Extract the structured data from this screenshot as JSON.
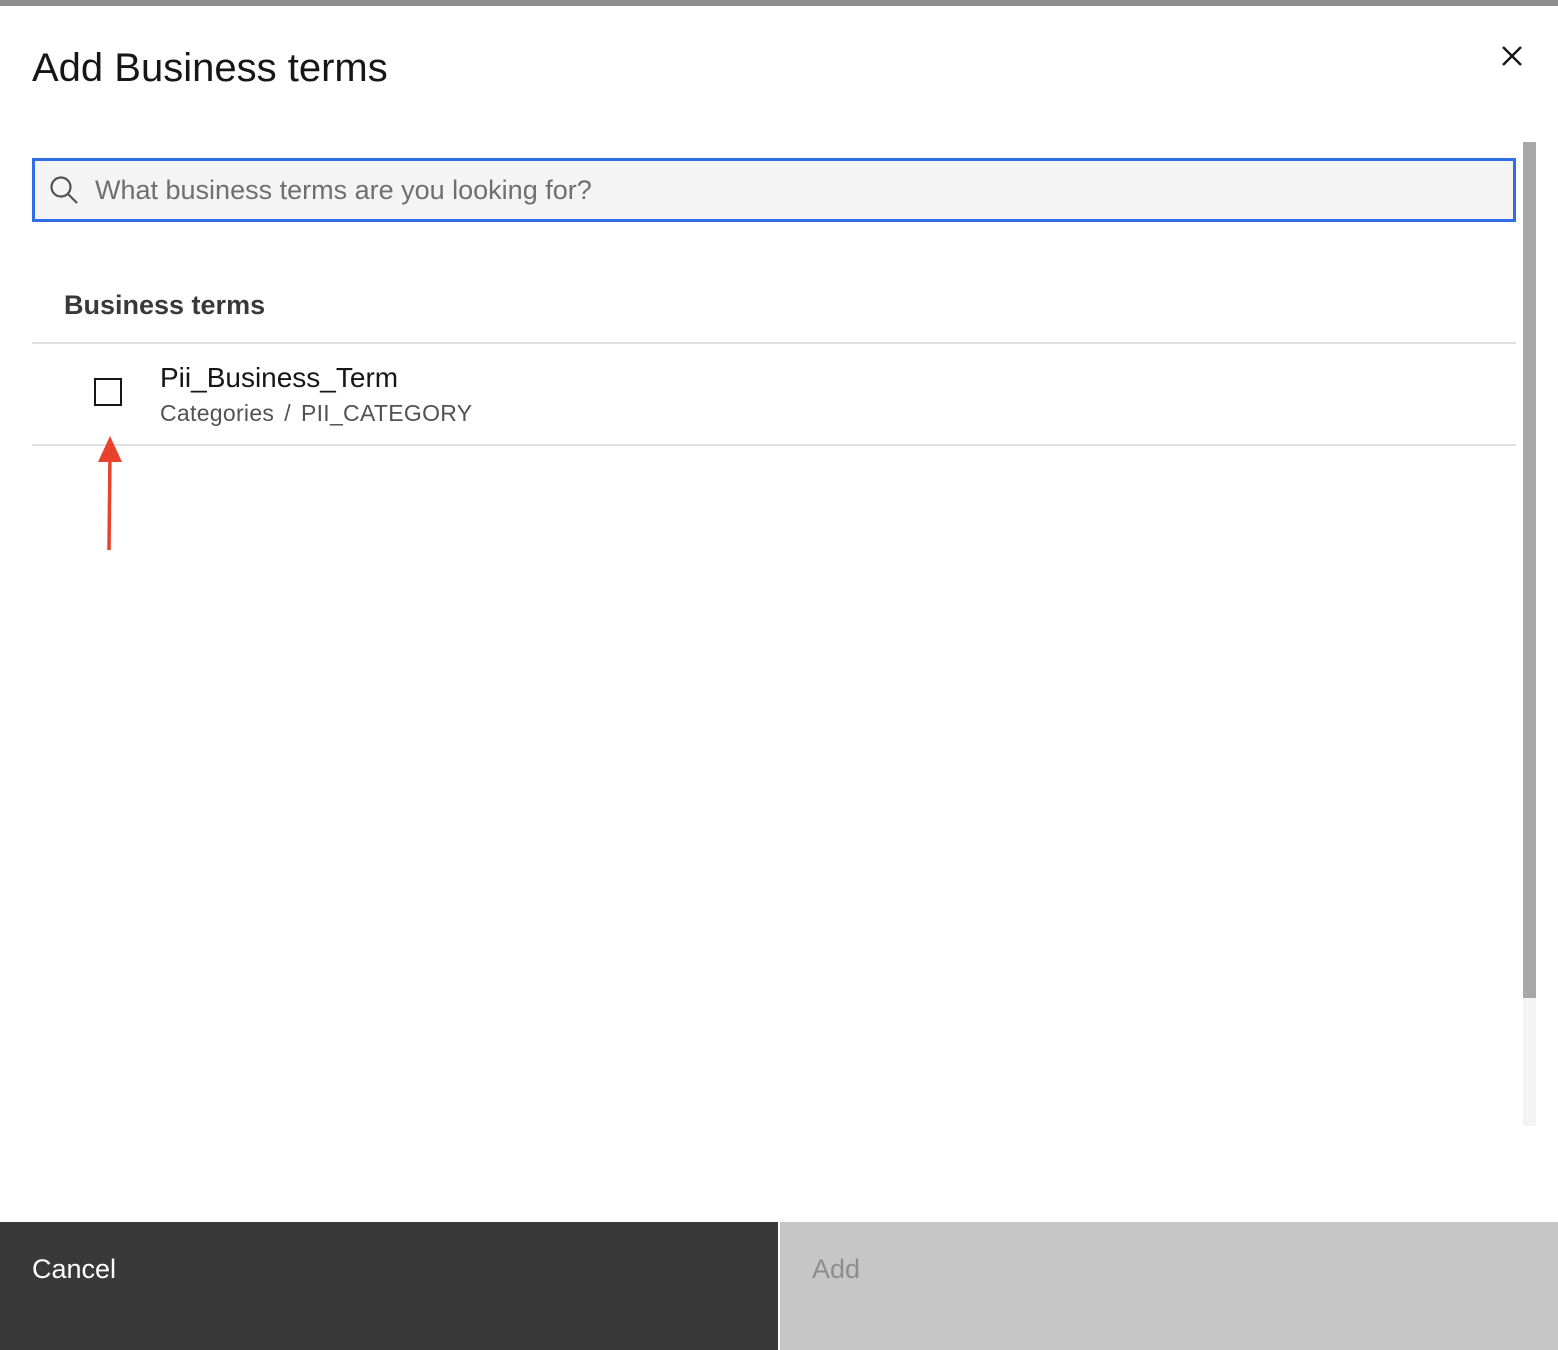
{
  "modal": {
    "title": "Add Business terms",
    "close_icon": "close-icon"
  },
  "search": {
    "placeholder": "What business terms are you looking for?",
    "value": "",
    "icon": "search-icon"
  },
  "section": {
    "heading": "Business terms"
  },
  "terms": [
    {
      "name": "Pii_Business_Term",
      "path": [
        "Categories",
        "PII_CATEGORY"
      ],
      "path_separator": "/",
      "checked": false
    }
  ],
  "footer": {
    "cancel_label": "Cancel",
    "add_label": "Add",
    "add_disabled": true
  },
  "colors": {
    "accent_focus": "#2f6ee6",
    "annotation_arrow": "#e8412c",
    "cancel_bg": "#393939",
    "add_disabled_bg": "#c6c6c6"
  }
}
